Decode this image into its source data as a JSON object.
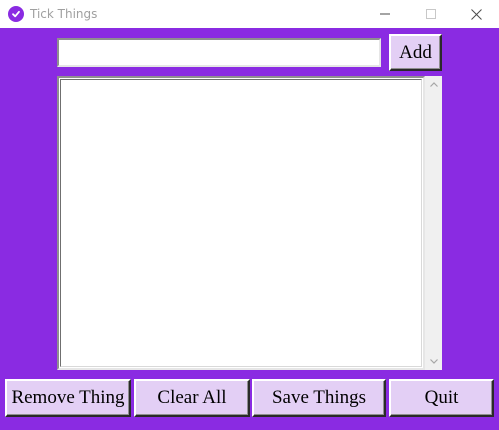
{
  "window": {
    "title": "Tick Things",
    "icon": "check-circle-icon",
    "controls": [
      "minimize-icon",
      "maximize-icon",
      "close-icon"
    ]
  },
  "entry": {
    "value": ""
  },
  "buttons": {
    "add": "Add",
    "remove": "Remove Thing",
    "clear": "Clear All",
    "save": "Save Things",
    "quit": "Quit"
  },
  "listbox": {
    "items": []
  },
  "colors": {
    "background": "#8a2be2",
    "button": "#e3cff5"
  }
}
